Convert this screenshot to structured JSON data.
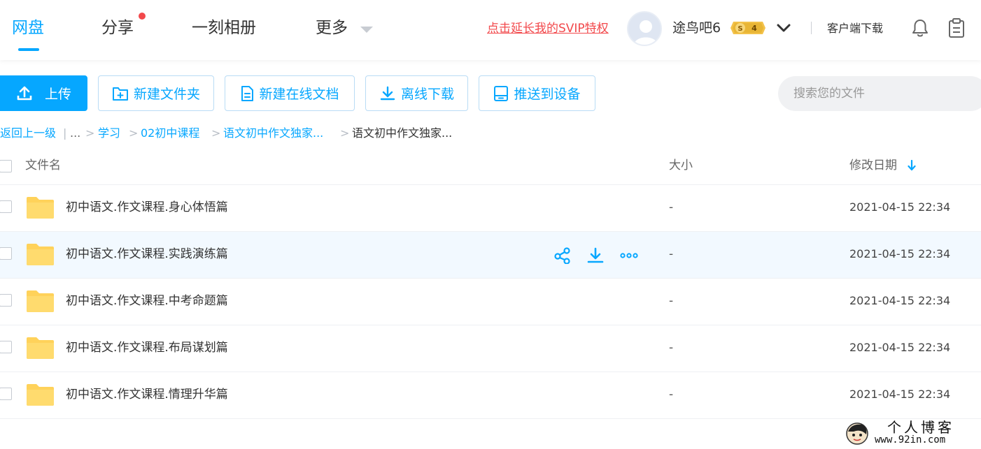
{
  "nav": {
    "items": [
      {
        "label": "网盘"
      },
      {
        "label": "分享"
      },
      {
        "label": "一刻相册"
      },
      {
        "label": "更多"
      }
    ],
    "svip_link": "点击延长我的SVIP特权",
    "username": "途鸟吧6",
    "vip_level": "4",
    "client_download": "客户端下载",
    "colors": {
      "accent": "#06a7ff",
      "alert": "#f2484b"
    }
  },
  "toolbar": {
    "upload": "上传",
    "new_folder": "新建文件夹",
    "new_doc": "新建在线文档",
    "offline_download": "离线下载",
    "push_device": "推送到设备",
    "search_placeholder": "搜索您的文件"
  },
  "breadcrumb": {
    "back": "返回上一级",
    "bar": "|",
    "ellipsis": "...",
    "sep": ">",
    "items": [
      "学习",
      "02初中课程",
      "语文初中作文独家..."
    ],
    "current": "语文初中作文独家..."
  },
  "table": {
    "columns": {
      "name": "文件名",
      "size": "大小",
      "modified": "修改日期"
    },
    "rows": [
      {
        "name": "初中语文.作文课程.身心体悟篇",
        "size": "-",
        "modified": "2021-04-15 22:34"
      },
      {
        "name": "初中语文.作文课程.实践演练篇",
        "size": "-",
        "modified": "2021-04-15 22:34"
      },
      {
        "name": "初中语文.作文课程.中考命题篇",
        "size": "-",
        "modified": "2021-04-15 22:34"
      },
      {
        "name": "初中语文.作文课程.布局谋划篇",
        "size": "-",
        "modified": "2021-04-15 22:34"
      },
      {
        "name": "初中语文.作文课程.情理升华篇",
        "size": "-",
        "modified": "2021-04-15 22:34"
      }
    ]
  },
  "watermark": {
    "line1": "个人博客",
    "line2": "www.92in.com"
  }
}
